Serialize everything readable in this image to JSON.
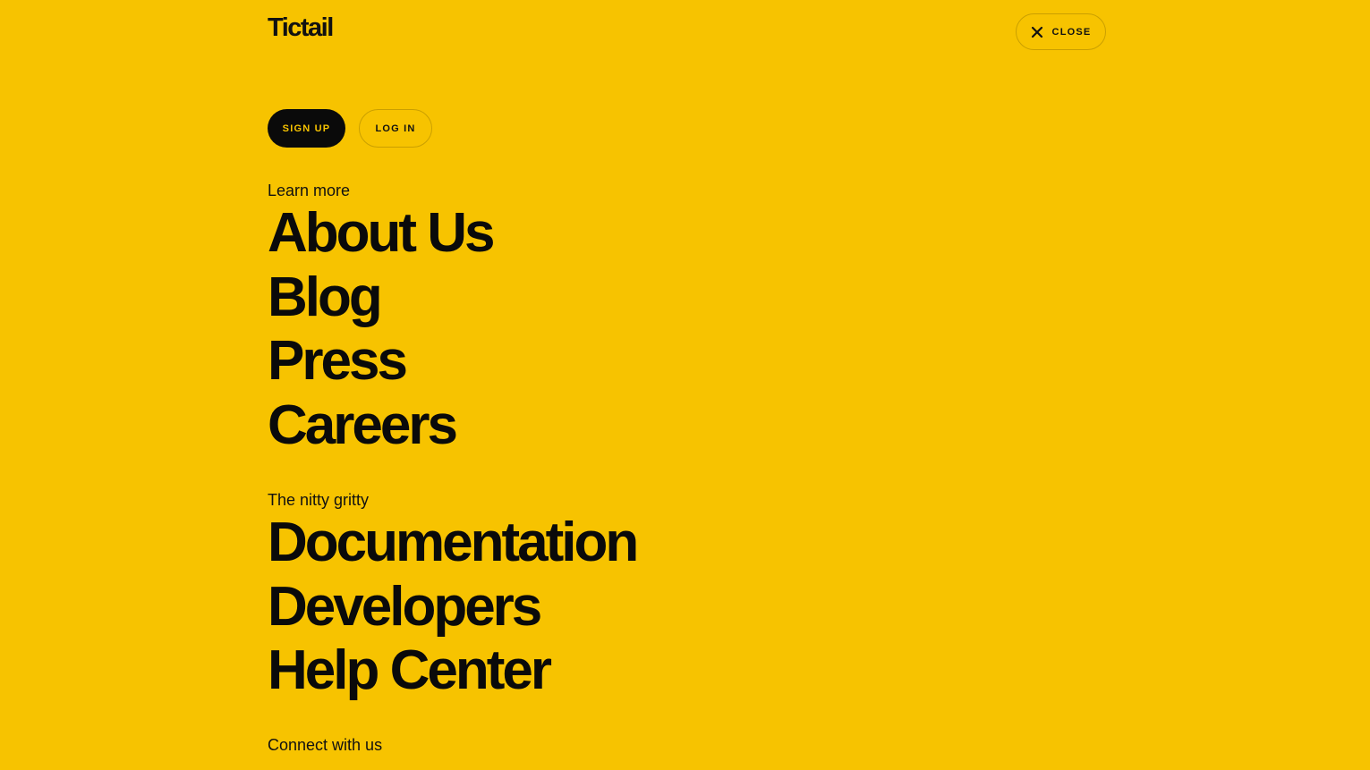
{
  "header": {
    "logo": "Tictail",
    "close_label": "CLOSE",
    "close_icon": "close-icon"
  },
  "auth": {
    "signup_label": "SIGN UP",
    "login_label": "LOG IN"
  },
  "sections": [
    {
      "label": "Learn more",
      "links": [
        "About Us",
        "Blog",
        "Press",
        "Careers"
      ]
    },
    {
      "label": "The nitty gritty",
      "links": [
        "Documentation",
        "Developers",
        "Help Center"
      ]
    },
    {
      "label": "Connect with us",
      "links": []
    }
  ],
  "colors": {
    "background": "#F7C300",
    "text": "#0A0A0A"
  }
}
